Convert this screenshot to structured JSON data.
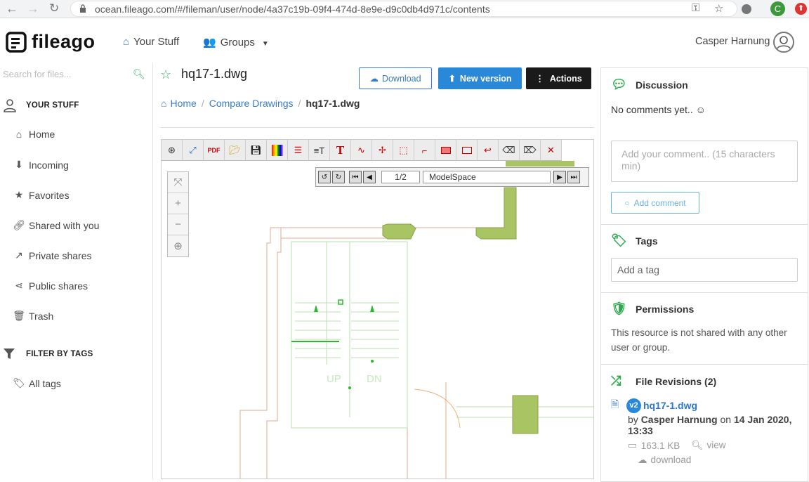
{
  "browser": {
    "url": "ocean.fileago.com/#/fileman/user/node/4a37c19b-09f4-474d-8e9e-d9c0db4d971c/contents",
    "profile_initial": "C"
  },
  "header": {
    "logo_text": "fileago",
    "nav": [
      {
        "label": "Your Stuff",
        "icon": "home-icon"
      },
      {
        "label": "Groups",
        "icon": "users-icon"
      }
    ],
    "user_name": "Casper Harnung"
  },
  "sidebar": {
    "search_placeholder": "Search for files...",
    "section_title": "YOUR STUFF",
    "items": [
      {
        "label": "Home",
        "icon": "home-icon"
      },
      {
        "label": "Incoming",
        "icon": "incoming-icon"
      },
      {
        "label": "Favorites",
        "icon": "star-icon"
      },
      {
        "label": "Shared with you",
        "icon": "link-icon"
      },
      {
        "label": "Private shares",
        "icon": "external-link-icon"
      },
      {
        "label": "Public shares",
        "icon": "share-icon"
      },
      {
        "label": "Trash",
        "icon": "trash-icon"
      }
    ],
    "filter_title": "FILTER BY TAGS",
    "filter_items": [
      {
        "label": "All tags",
        "icon": "tags-icon"
      }
    ]
  },
  "file": {
    "title": "hq17-1.dwg",
    "buttons": {
      "download": "Download",
      "new_version": "New version",
      "actions": "Actions"
    },
    "breadcrumb": [
      "Home",
      "Compare Drawings",
      "hq17-1.dwg"
    ]
  },
  "viewer": {
    "page": "1/2",
    "space": "ModelSpace"
  },
  "panel": {
    "discussion": {
      "title": "Discussion",
      "empty": "No comments yet.. ☺",
      "placeholder": "Add your comment.. (15 characters min)",
      "add_button": "Add comment"
    },
    "tags": {
      "title": "Tags",
      "placeholder": "Add a tag"
    },
    "permissions": {
      "title": "Permissions",
      "text": "This resource is not shared with any other user or group."
    },
    "revisions": {
      "title": "File Revisions (2)",
      "items": [
        {
          "version": "v2",
          "name": "hq17-1.dwg",
          "by": "by ",
          "user": "Casper Harnung",
          "on": " on ",
          "date": "14 Jan 2020, 13:33",
          "size": "163.1 KB",
          "view": "view",
          "download": "download"
        }
      ]
    }
  }
}
